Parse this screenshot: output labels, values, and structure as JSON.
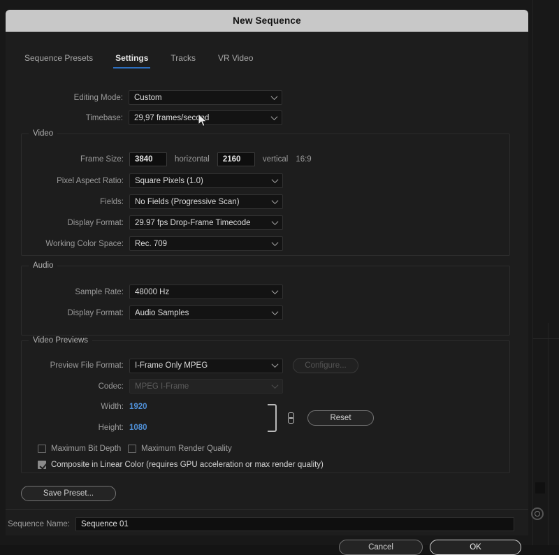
{
  "window": {
    "title": "New Sequence"
  },
  "tabs": [
    {
      "label": "Sequence Presets",
      "active": false
    },
    {
      "label": "Settings",
      "active": true
    },
    {
      "label": "Tracks",
      "active": false
    },
    {
      "label": "VR Video",
      "active": false
    }
  ],
  "top_fields": {
    "editing_mode_label": "Editing Mode:",
    "editing_mode_value": "Custom",
    "timebase_label": "Timebase:",
    "timebase_value": "29,97  frames/second"
  },
  "video": {
    "legend": "Video",
    "frame_size_label": "Frame Size:",
    "frame_width": "3840",
    "horizontal_label": "horizontal",
    "frame_height": "2160",
    "vertical_label": "vertical",
    "aspect_ratio": "16:9",
    "pixel_aspect_label": "Pixel Aspect Ratio:",
    "pixel_aspect_value": "Square Pixels (1.0)",
    "fields_label": "Fields:",
    "fields_value": "No Fields (Progressive Scan)",
    "display_format_label": "Display Format:",
    "display_format_value": "29.97 fps Drop-Frame Timecode",
    "color_space_label": "Working Color Space:",
    "color_space_value": "Rec. 709"
  },
  "audio": {
    "legend": "Audio",
    "sample_rate_label": "Sample Rate:",
    "sample_rate_value": "48000 Hz",
    "display_format_label": "Display Format:",
    "display_format_value": "Audio Samples"
  },
  "video_previews": {
    "legend": "Video Previews",
    "preview_format_label": "Preview File Format:",
    "preview_format_value": "I-Frame Only MPEG",
    "configure_label": "Configure...",
    "codec_label": "Codec:",
    "codec_value": "MPEG I-Frame",
    "width_label": "Width:",
    "width_value": "1920",
    "height_label": "Height:",
    "height_value": "1080",
    "reset_label": "Reset"
  },
  "checkboxes": {
    "max_bit_depth_label": "Maximum Bit Depth",
    "max_bit_depth_checked": false,
    "max_render_quality_label": "Maximum Render Quality",
    "max_render_quality_checked": false,
    "composite_linear_label": "Composite in Linear Color (requires GPU acceleration or max render quality)",
    "composite_linear_checked": true
  },
  "footer": {
    "save_preset_label": "Save Preset...",
    "sequence_name_label": "Sequence Name:",
    "sequence_name_value": "Sequence 01",
    "cancel_label": "Cancel",
    "ok_label": "OK"
  },
  "colors": {
    "accent_blue": "#2d6fbf",
    "value_blue": "#4f8fd6",
    "titlebar_bg": "#c8c8c8",
    "dialog_bg": "#1d1d1d",
    "field_bg": "#131313"
  }
}
